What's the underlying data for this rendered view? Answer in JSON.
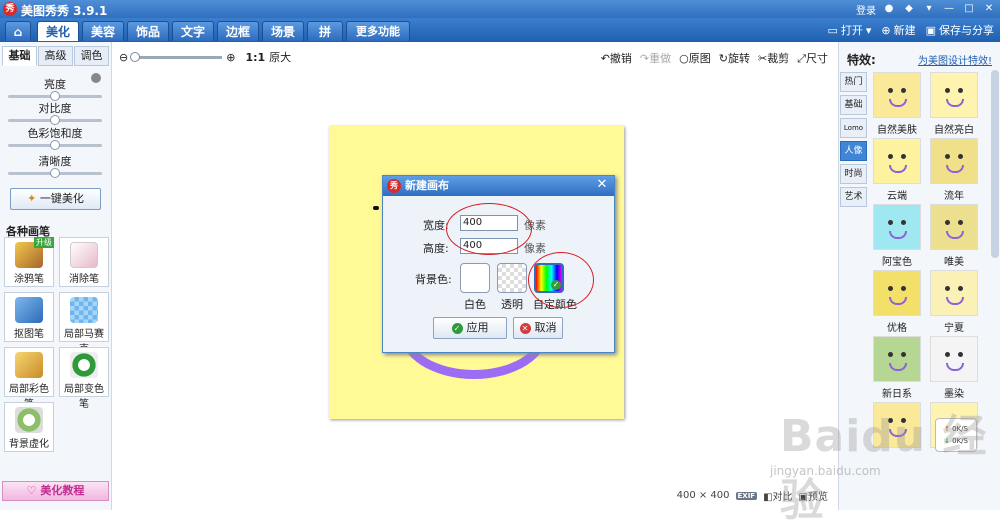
{
  "app": {
    "title": "美图秀秀 3.9.1",
    "logo_char": "秀"
  },
  "titlebar": {
    "login": "登录",
    "icons": [
      "qq-icon",
      "skin-icon",
      "menu-icon",
      "minimize-icon",
      "maximize-icon",
      "close-icon"
    ]
  },
  "nav": {
    "tabs": [
      {
        "label": "美化",
        "active": true
      },
      {
        "label": "美容"
      },
      {
        "label": "饰品"
      },
      {
        "label": "文字"
      },
      {
        "label": "边框"
      },
      {
        "label": "场景"
      },
      {
        "label": "拼图"
      },
      {
        "label": "更多功能 ▾"
      }
    ],
    "open": "打开",
    "new": "新建",
    "save": "保存与分享"
  },
  "left": {
    "subtabs": [
      "基础",
      "高级",
      "调色"
    ],
    "sliders": [
      {
        "label": "亮度",
        "value": 0.5
      },
      {
        "label": "对比度",
        "value": 0.5
      },
      {
        "label": "色彩饱和度",
        "value": 0.5
      },
      {
        "label": "清晰度",
        "value": 0.5
      }
    ],
    "one_key": "一键美化",
    "section_title": "各种画笔",
    "brushes": [
      {
        "label": "涂鸦笔",
        "badge": "升级"
      },
      {
        "label": "消除笔"
      },
      {
        "label": "抠图笔"
      },
      {
        "label": "局部马赛克"
      },
      {
        "label": "局部彩色笔"
      },
      {
        "label": "局部变色笔"
      },
      {
        "label": "背景虚化"
      }
    ],
    "tutorial": "美化教程"
  },
  "toolbar": {
    "zoom_ratio": "1:1",
    "zoom_original": "原大",
    "undo": "撤销",
    "redo": "重做",
    "original": "原图",
    "rotate": "旋转",
    "crop": "裁剪",
    "size": "尺寸"
  },
  "dialog": {
    "title": "新建画布",
    "width_label": "宽度:",
    "width_value": "400",
    "height_label": "高度:",
    "height_value": "400",
    "unit": "像素",
    "bg_label": "背景色:",
    "bg_options": [
      "白色",
      "透明",
      "自定颜色"
    ],
    "apply": "应用",
    "cancel": "取消"
  },
  "status": {
    "dimensions": "400 × 400",
    "exif": "EXIF",
    "compare": "对比",
    "preview": "预览"
  },
  "right": {
    "title": "特效:",
    "link": "为美图设计特效!",
    "categories": [
      "热门",
      "基础",
      "Lomo",
      "人像",
      "时尚",
      "艺术"
    ],
    "active_category": "人像",
    "effects": [
      {
        "label": "自然美肤",
        "color": "#fbe99a"
      },
      {
        "label": "自然亮白",
        "color": "#fff3b0"
      },
      {
        "label": "云端",
        "color": "#fdf2a0"
      },
      {
        "label": "流年",
        "color": "#f1e08a"
      },
      {
        "label": "阿宝色",
        "color": "#9fe8f2"
      },
      {
        "label": "唯美",
        "color": "#ece08e"
      },
      {
        "label": "优格",
        "color": "#f3e06a"
      },
      {
        "label": "宁夏",
        "color": "#fbf0b5"
      },
      {
        "label": "新日系",
        "color": "#b6d794"
      },
      {
        "label": "墨染",
        "color": "#f4f4f4"
      },
      {
        "label": "",
        "color": "#fbe99a"
      },
      {
        "label": "",
        "color": "#fff3b0"
      }
    ]
  },
  "speed": {
    "up": "0K/S",
    "down": "0K/S"
  },
  "watermark": {
    "main": "Baidu 经验",
    "sub": "jingyan.baidu.com"
  },
  "colors": {
    "accent": "#2f6ebf",
    "canvas": "#fffa96",
    "annotation": "#d42020",
    "stroke": "#9d6cf5"
  }
}
